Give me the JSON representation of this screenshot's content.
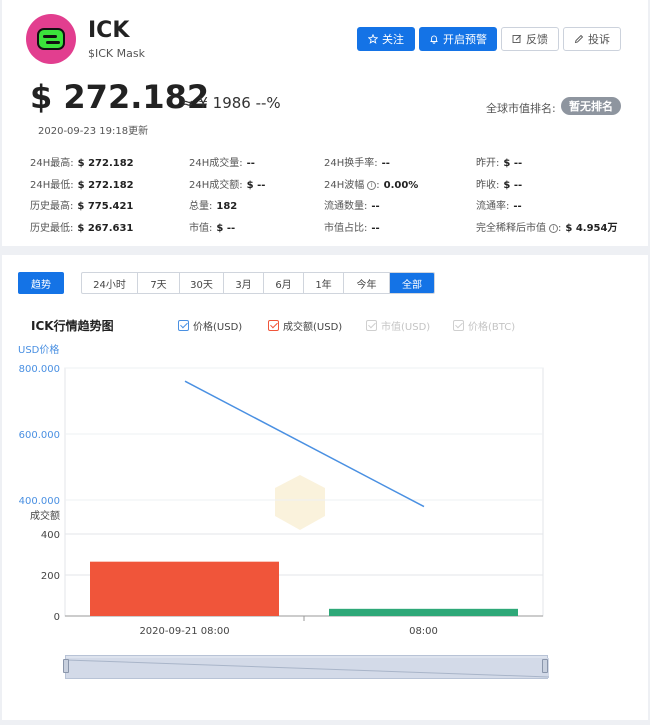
{
  "coin": {
    "symbol": "ICK",
    "name": "$ICK Mask",
    "price": "$ 272.182",
    "approx": "≈ ¥ 1986  --%",
    "updated": "2020-09-23 19:18更新",
    "rank_label": "全球市值排名:",
    "rank_value": "暂无排名"
  },
  "actions": {
    "follow": "关注",
    "alert": "开启预警",
    "feedback": "反馈",
    "complain": "投诉"
  },
  "stats": [
    {
      "label": "24H最高:",
      "value": "$ 272.182"
    },
    {
      "label": "24H成交量:",
      "value": "--"
    },
    {
      "label": "24H换手率:",
      "value": "--"
    },
    {
      "label": "昨开:",
      "value": "$ --"
    },
    {
      "label": "24H最低:",
      "value": "$ 272.182"
    },
    {
      "label": "24H成交额:",
      "value": "$ --"
    },
    {
      "label": "24H波幅",
      "value": "0.00%"
    },
    {
      "label": "昨收:",
      "value": "$ --"
    },
    {
      "label": "历史最高:",
      "value": "$ 775.421"
    },
    {
      "label": "总量:",
      "value": "182"
    },
    {
      "label": "流通数量:",
      "value": "--"
    },
    {
      "label": "流通率:",
      "value": "--"
    },
    {
      "label": "历史最低:",
      "value": "$ 267.631"
    },
    {
      "label": "市值:",
      "value": "$ --"
    },
    {
      "label": "市值占比:",
      "value": "--"
    },
    {
      "label": "完全稀释后市值",
      "value": "$ 4.954万"
    }
  ],
  "tabs": {
    "trend": "趋势",
    "ranges": [
      "24小时",
      "7天",
      "30天",
      "3月",
      "6月",
      "1年",
      "今年",
      "全部"
    ],
    "active_range": "全部"
  },
  "chart_title": "ICK行情趋势图",
  "legend": [
    {
      "label": "价格(USD)",
      "checked": true,
      "color": "#4a90e2"
    },
    {
      "label": "成交额(USD)",
      "checked": true,
      "color": "#f0553a"
    },
    {
      "label": "市值(USD)",
      "checked": false,
      "color": "#cfcfcf"
    },
    {
      "label": "价格(BTC)",
      "checked": false,
      "color": "#cfcfcf"
    }
  ],
  "chart_data": {
    "type": "line",
    "categories": [
      "2020-09-21 08:00",
      "08:00"
    ],
    "price_axis": {
      "label": "USD价格",
      "ticks": [
        "800.000",
        "600.000",
        "400.000"
      ],
      "ylim": [
        300,
        800
      ]
    },
    "volume_axis": {
      "label": "成交额",
      "ticks": [
        "400",
        "200",
        "0"
      ],
      "ylim": [
        0,
        400
      ]
    },
    "series": [
      {
        "name": "价格(USD)",
        "kind": "line",
        "color": "#4a90e2",
        "x": [
          0,
          1
        ],
        "values": [
          760,
          380
        ]
      },
      {
        "name": "成交额(USD)",
        "kind": "bar",
        "color": "#f0553a",
        "values": [
          265,
          0
        ]
      },
      {
        "name": "",
        "kind": "bar",
        "color": "#2ea878",
        "values": [
          0,
          35
        ]
      }
    ]
  }
}
